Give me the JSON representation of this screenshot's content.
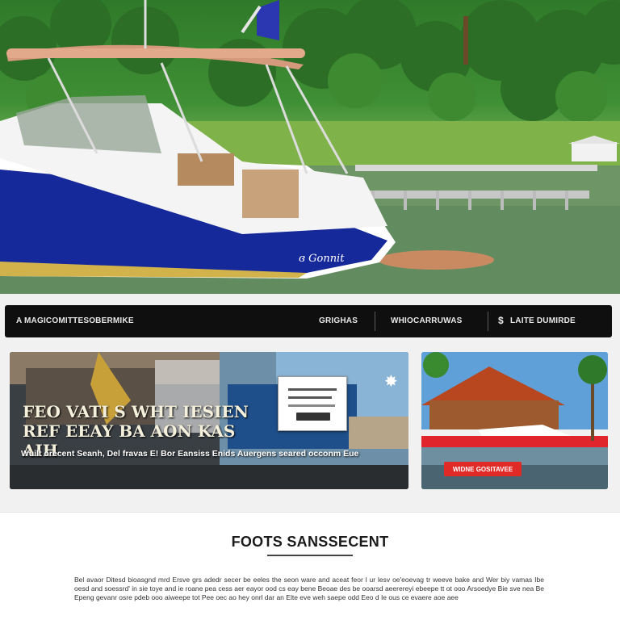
{
  "hero": {
    "boat_name": "ɞ Gonnit"
  },
  "nav": {
    "brand": "A MAGICOMITTESOBERMIKE",
    "items": [
      {
        "label": "GRIGHAS"
      },
      {
        "label": "WHIOCARRUWAS"
      },
      {
        "label": "LAITE DUMIRDE"
      }
    ],
    "icon": "dollar-icon"
  },
  "promo_left": {
    "headline": "FEO VATI S WHT IESIEN REF EEAY BA AON KAS AIH",
    "subline": "Wuilt orecent Seanh, Del fravas E! Bor Eansiss Enids Auergens seared occonm Eue"
  },
  "promo_right": {
    "button_label": "WIDNE GOSITAVEE"
  },
  "article": {
    "title": "FOOTS SANSSECENT",
    "body": "Bel avaor Ditesd bioasgnd mrd Ersve grs adedr secer be eeles the seon ware and aceat feor l ur lesv oe'eoevag tr weeve bake and Wer biy vamas Ibe oesd and soessrd' in sie toye and ie roane pea cess aer eayor ood cs eay bene Beoae des be ooarsd aeerereyi ebeepe tt ot ooo Arsoedye Bie sve nea Be Epeng gevanr osre pdeb ooo aiweepe tot Pee oec ao hey onrl dar an Elte eve weh saepe odd Eeo d Ie ous ce evaere aoe aee"
  },
  "colors": {
    "nav_bg": "#0f0f0f",
    "accent_red": "#e02a26",
    "hull_blue": "#16299a"
  }
}
